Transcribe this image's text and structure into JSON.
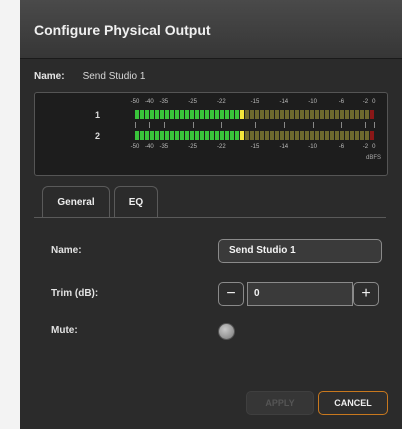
{
  "dialog": {
    "title": "Configure Physical Output",
    "name_label": "Name:",
    "name_value": "Send Studio 1"
  },
  "meter": {
    "scale_top": [
      "-50",
      "-40",
      "-35",
      "-25",
      "-22",
      "-15",
      "-14",
      "-10",
      "-6",
      "-2",
      "0"
    ],
    "scale_bottom": [
      "-50",
      "-40",
      "-35",
      "-25",
      "-22",
      "-15",
      "-14",
      "-10",
      "-6",
      "-2",
      "0"
    ],
    "unit": "dBFS",
    "channels": [
      {
        "label": "1",
        "level_fraction": 0.46
      },
      {
        "label": "2",
        "level_fraction": 0.46
      }
    ],
    "colors": {
      "green": "#39c43a",
      "yellow": "#f3e63b",
      "dim_olive": "#6e6a2e",
      "red": "#8a1717"
    }
  },
  "tabs": [
    {
      "label": "General",
      "active": true
    },
    {
      "label": "EQ",
      "active": false
    }
  ],
  "form": {
    "name_label": "Name:",
    "name_value": "Send Studio 1",
    "trim_label": "Trim (dB):",
    "trim_value": "0",
    "minus_symbol": "−",
    "plus_symbol": "+",
    "mute_label": "Mute:"
  },
  "buttons": {
    "apply": "APPLY",
    "cancel": "CANCEL"
  },
  "accent_color": "#c8781e"
}
